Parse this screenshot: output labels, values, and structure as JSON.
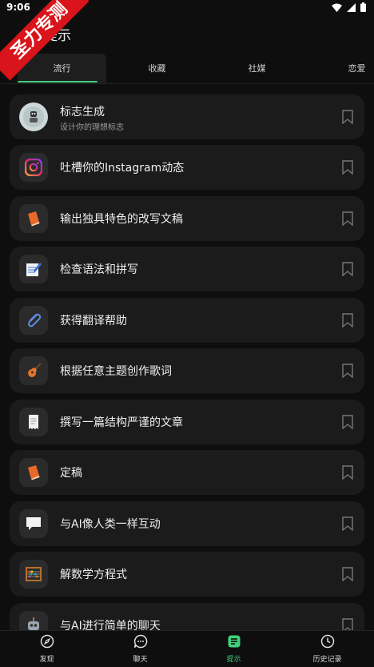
{
  "status": {
    "time": "9:06"
  },
  "watermark": "圣力专测",
  "header": {
    "title": "提示"
  },
  "tabs": [
    {
      "label": "流行",
      "active": true
    },
    {
      "label": "收藏",
      "active": false
    },
    {
      "label": "社媒",
      "active": false
    },
    {
      "label": "恋爱",
      "active": false
    }
  ],
  "prompts": [
    {
      "title": "标志生成",
      "subtitle": "设计你的理想标志",
      "icon": "robot-logo-icon"
    },
    {
      "title": "吐槽你的Instagram动态",
      "icon": "instagram-icon"
    },
    {
      "title": "输出独具特色的改写文稿",
      "icon": "book-icon"
    },
    {
      "title": "检查语法和拼写",
      "icon": "memo-pencil-icon"
    },
    {
      "title": "获得翻译帮助",
      "icon": "paperclip-icon"
    },
    {
      "title": "根据任意主题创作歌词",
      "icon": "guitar-icon"
    },
    {
      "title": "撰写一篇结构严谨的文章",
      "icon": "receipt-icon"
    },
    {
      "title": "定稿",
      "icon": "book-icon"
    },
    {
      "title": "与AI像人类一样互动",
      "icon": "speech-bubble-icon"
    },
    {
      "title": "解数学方程式",
      "icon": "abacus-icon"
    },
    {
      "title": "与AI进行简单的聊天",
      "icon": "robot-icon"
    }
  ],
  "bottom_nav": [
    {
      "label": "发现",
      "icon": "compass-icon"
    },
    {
      "label": "聊天",
      "icon": "chat-icon"
    },
    {
      "label": "提示",
      "icon": "prompt-list-icon",
      "active": true
    },
    {
      "label": "历史记录",
      "icon": "clock-icon"
    }
  ],
  "colors": {
    "accent": "#3fd07a",
    "background": "#0e0e0e",
    "card": "#1b1b1b",
    "watermark": "#d9141b"
  }
}
